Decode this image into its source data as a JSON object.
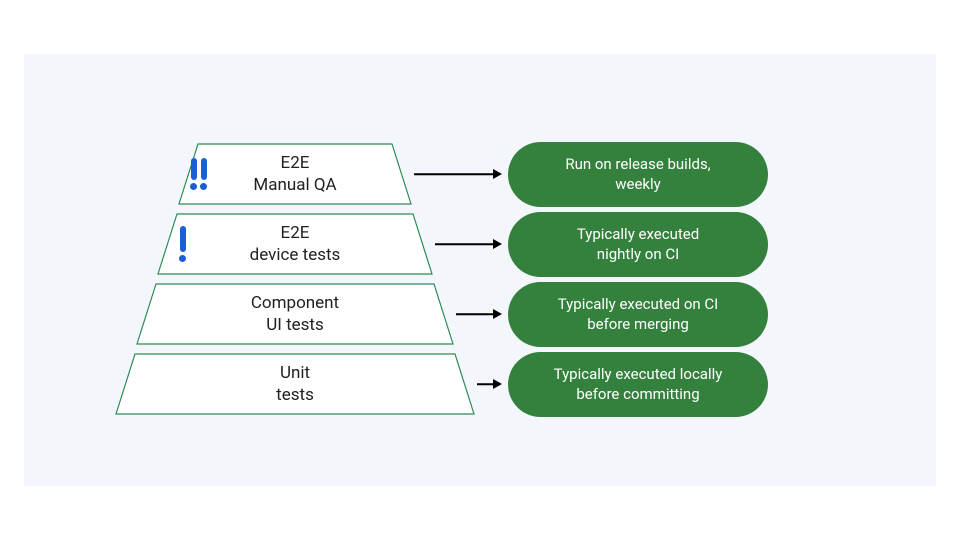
{
  "colors": {
    "background": "#f3f6fb",
    "trapezoid_stroke": "#2e8b57",
    "trapezoid_fill": "#ffffff",
    "pill_fill": "#34803d",
    "pill_text": "#ffffff",
    "label_text": "#202124",
    "emphasis": "#1a5fd6",
    "arrow": "#000000"
  },
  "pyramid": [
    {
      "label_line1": "E2E",
      "label_line2": "Manual QA",
      "desc_line1": "Run on release builds,",
      "desc_line2": "weekly",
      "emphasis_level": 2
    },
    {
      "label_line1": "E2E",
      "label_line2": "device tests",
      "desc_line1": "Typically executed",
      "desc_line2": "nightly on CI",
      "emphasis_level": 1
    },
    {
      "label_line1": "Component",
      "label_line2": "UI tests",
      "desc_line1": "Typically executed on CI",
      "desc_line2": "before merging",
      "emphasis_level": 0
    },
    {
      "label_line1": "Unit",
      "label_line2": "tests",
      "desc_line1": "Typically executed locally",
      "desc_line2": "before committing",
      "emphasis_level": 0
    }
  ]
}
